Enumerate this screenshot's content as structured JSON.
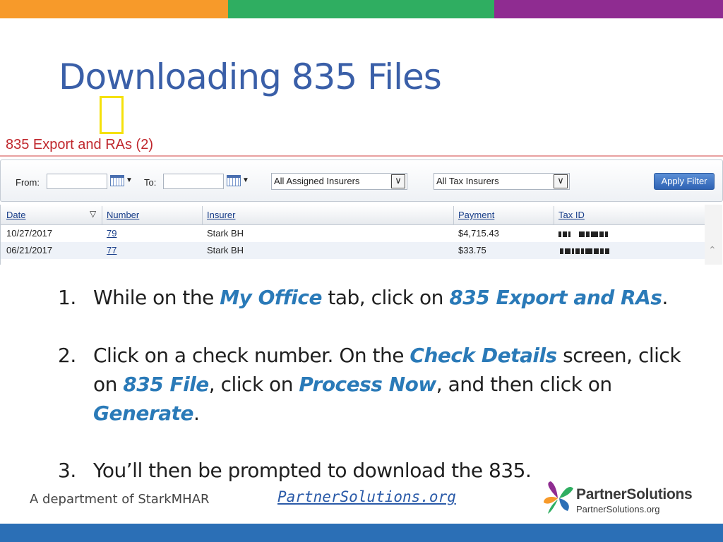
{
  "colors": {
    "top_bar": [
      "#f79a2a",
      "#2fae61",
      "#8f2c91"
    ],
    "title": "#3a5fa8",
    "emphasis": "#2a7ab8",
    "bottom_bar": "#2b6fb6",
    "highlight_box": "#f5e10a"
  },
  "slide": {
    "title": "Downloading 835 Files"
  },
  "screenshot": {
    "title": "835 Export and RAs (2)",
    "filters": {
      "from_label": "From:",
      "from_value": "",
      "to_label": "To:",
      "to_value": "",
      "insurer_select": "All Assigned Insurers",
      "tax_select": "All Tax Insurers",
      "apply_button": "Apply Filter"
    },
    "table": {
      "columns": [
        "Date",
        "Number",
        "Insurer",
        "Payment",
        "Tax ID"
      ],
      "sort_indicator": "▽",
      "rows": [
        {
          "date": "10/27/2017",
          "number": "79",
          "insurer": "Stark BH",
          "payment": "$4,715.43",
          "tax_id": "redacted"
        },
        {
          "date": "06/21/2017",
          "number": "77",
          "insurer": "Stark BH",
          "payment": "$33.75",
          "tax_id": "redacted"
        }
      ]
    }
  },
  "steps": [
    {
      "number": "1.",
      "t1": "While on the ",
      "e1": "My Office",
      "t2": " tab, click on ",
      "e2": "835 Export and RAs",
      "t3": "."
    },
    {
      "number": "2.",
      "t1": "Click on a check number. On the ",
      "e1": "Check Details",
      "t2": " screen, click on ",
      "e2": "835 File",
      "t3": ", click on ",
      "e3": "Process Now",
      "t4": ", and then click on ",
      "e4": "Generate",
      "t5": "."
    },
    {
      "number": "3.",
      "t1": "You’ll then be prompted to download the 835."
    }
  ],
  "footer": {
    "department": "A department of StarkMHAR",
    "url": "PartnerSolutions.org",
    "logo_main": "PartnerSolutions",
    "logo_sub": "PartnerSolutions.org"
  },
  "icons": {
    "calendar": "calendar-icon",
    "dropdown": "chevron-down-icon",
    "sort": "sort-arrow-icon",
    "scroll": "scroll-up-icon",
    "logo": "butterfly-logo-icon"
  }
}
